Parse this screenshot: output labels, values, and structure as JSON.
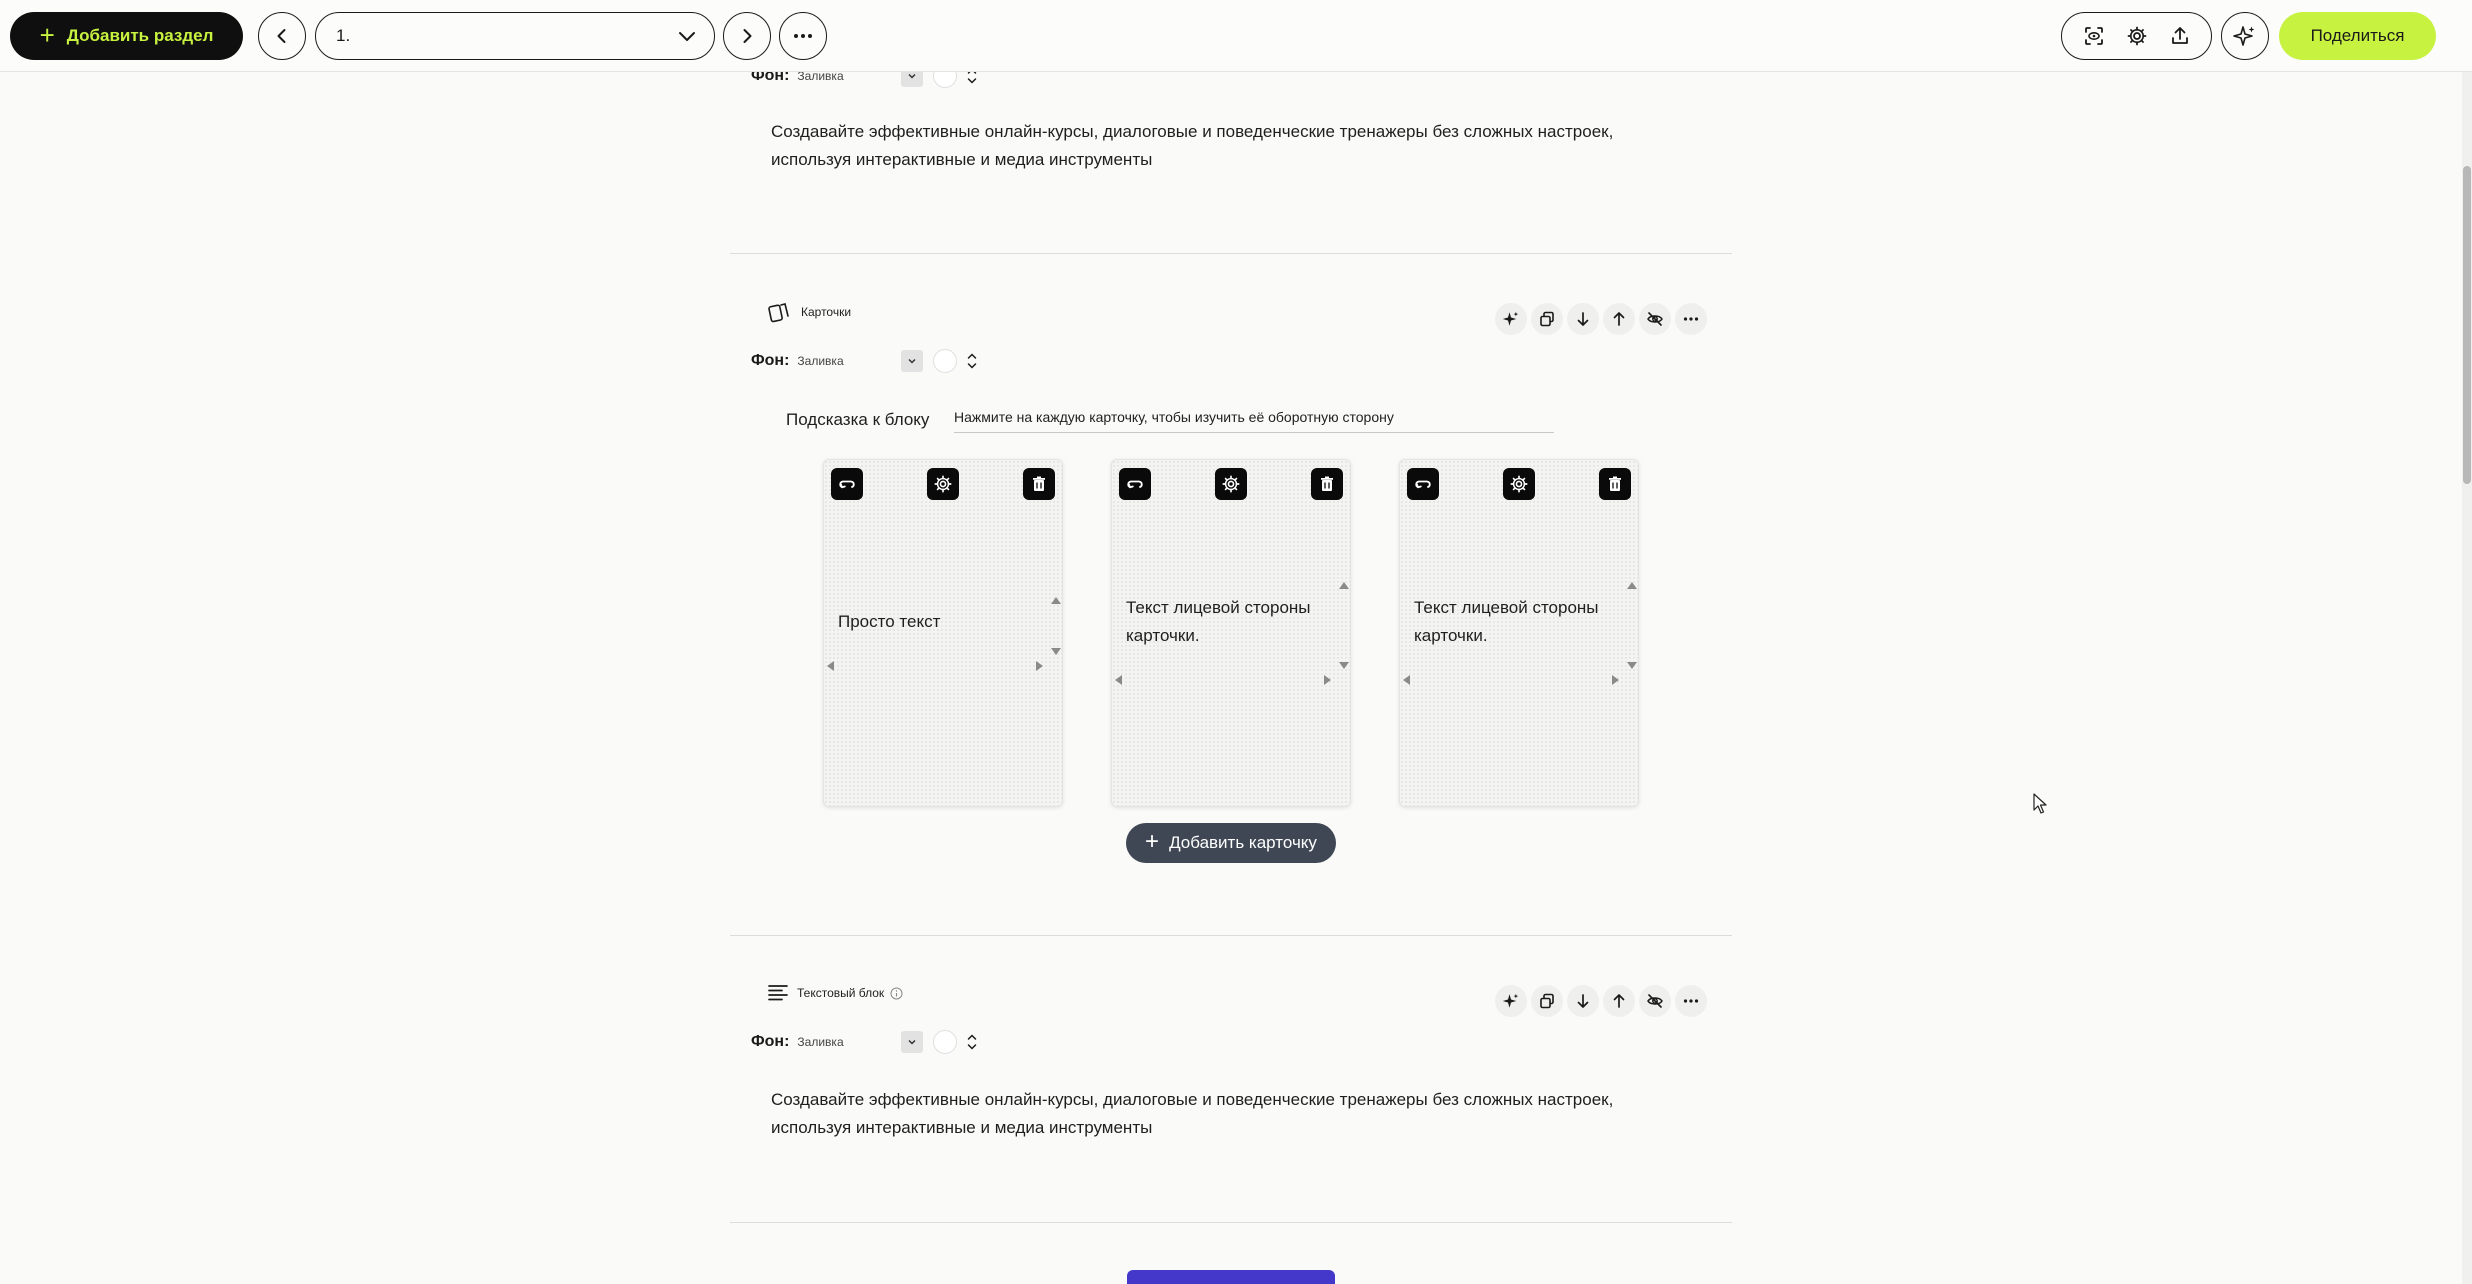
{
  "topbar": {
    "add_section_label": "Добавить раздел",
    "page_select_value": "1.",
    "share_label": "Поделиться"
  },
  "blocks": [
    {
      "id": "text-top",
      "fon_label": "Фон:",
      "fon_value": "Заливка",
      "body": [
        "Создавайте эффективные онлайн-курсы, диалоговые и поведенческие тренажеры без сложных настроек,",
        "используя интерактивные и медиа инструменты"
      ]
    },
    {
      "id": "cards",
      "title": "Карточки",
      "fon_label": "Фон:",
      "fon_value": "Заливка",
      "hint_label": "Подсказка к блоку",
      "hint_value": "Нажмите на каждую карточку, чтобы изучить её оборотную сторону",
      "cards": [
        {
          "text": "Просто текст"
        },
        {
          "text": "Текст лицевой стороны карточки."
        },
        {
          "text": "Текст лицевой стороны карточки."
        }
      ],
      "add_card_label": "Добавить карточку"
    },
    {
      "id": "text-bottom",
      "title": "Текстовый блок",
      "fon_label": "Фон:",
      "fon_value": "Заливка",
      "body": [
        "Создавайте эффективные онлайн-курсы, диалоговые и поведенческие тренажеры без сложных настроек,",
        "используя интерактивные и медиа инструменты"
      ]
    }
  ],
  "colors": {
    "accent_lime": "#c8f240",
    "dark": "#0f0f0f",
    "add_card_bg": "#3f4754",
    "bottom_button": "#4338ca"
  }
}
